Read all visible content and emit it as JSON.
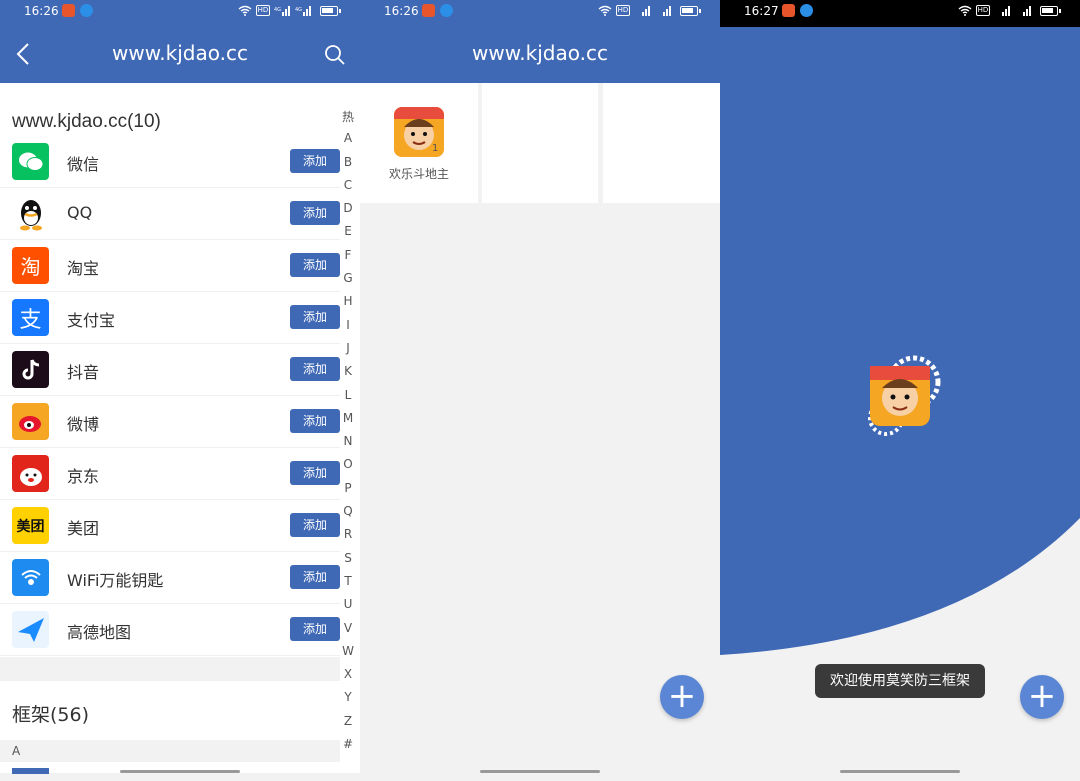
{
  "screen1": {
    "status": {
      "time": "16:26"
    },
    "title": "www.kjdao.cc",
    "group_header": "www.kjdao.cc(10)",
    "apps": [
      {
        "name": "微信",
        "btn": "添加",
        "icon": "wechat-icon",
        "color": "#07c160"
      },
      {
        "name": "QQ",
        "btn": "添加",
        "icon": "qq-icon",
        "color": "#ffffff"
      },
      {
        "name": "淘宝",
        "btn": "添加",
        "icon": "taobao-icon",
        "color": "#ff5000"
      },
      {
        "name": "支付宝",
        "btn": "添加",
        "icon": "alipay-icon",
        "color": "#1677ff"
      },
      {
        "name": "抖音",
        "btn": "添加",
        "icon": "douyin-icon",
        "color": "#1c0b19"
      },
      {
        "name": "微博",
        "btn": "添加",
        "icon": "weibo-icon",
        "color": "#f5a623"
      },
      {
        "name": "京东",
        "btn": "添加",
        "icon": "jd-icon",
        "color": "#e1251b"
      },
      {
        "name": "美团",
        "btn": "添加",
        "icon": "meituan-icon",
        "color": "#ffd100"
      },
      {
        "name": "WiFi万能钥匙",
        "btn": "添加",
        "icon": "wifi-key-icon",
        "color": "#1e8bf0"
      },
      {
        "name": "高德地图",
        "btn": "添加",
        "icon": "amap-icon",
        "color": "#1a8cff"
      }
    ],
    "framework_header": "框架(56)",
    "letter_section": "A",
    "index_letters": [
      "热",
      "A",
      "B",
      "C",
      "D",
      "E",
      "F",
      "G",
      "H",
      "I",
      "J",
      "K",
      "L",
      "M",
      "N",
      "O",
      "P",
      "Q",
      "R",
      "S",
      "T",
      "U",
      "V",
      "W",
      "X",
      "Y",
      "Z",
      "#"
    ]
  },
  "screen2": {
    "status": {
      "time": "16:26"
    },
    "title": "www.kjdao.cc",
    "app_label": "欢乐斗地主",
    "app_badge": "1",
    "fab": "+"
  },
  "screen3": {
    "status": {
      "time": "16:27"
    },
    "toast": "欢迎使用莫笑防三框架",
    "fab": "+"
  },
  "colors": {
    "primary": "#3f68b5",
    "fab": "#5b86d6"
  }
}
